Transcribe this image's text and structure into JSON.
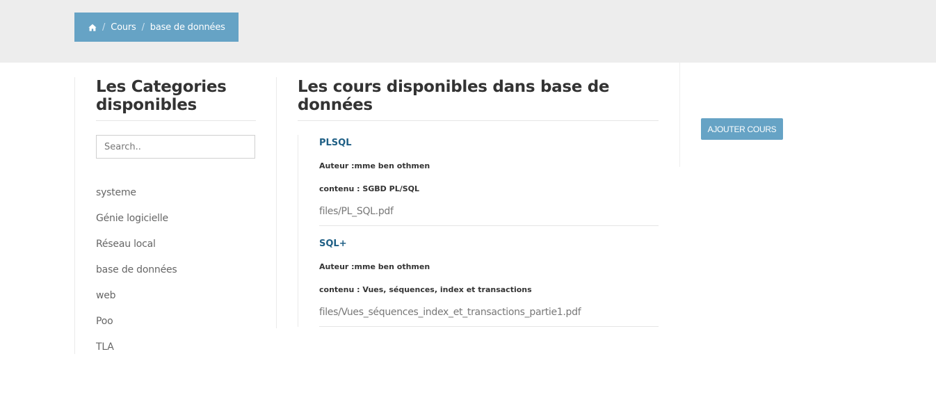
{
  "breadcrumb": {
    "home_icon": "home-icon",
    "items": [
      "Cours",
      "base de données"
    ],
    "separator": "/"
  },
  "sidebar": {
    "heading": "Les Categories disponibles",
    "search_placeholder": "Search..",
    "categories": [
      "systeme",
      "Génie logicielle",
      "Réseau local",
      "base de données",
      "web",
      "Poo",
      "TLA"
    ]
  },
  "main": {
    "heading": "Les cours disponibles dans base de données",
    "courses": [
      {
        "title": "PLSQL",
        "author": "Auteur :mme ben othmen",
        "content": "contenu : SGBD PL/SQL",
        "file": "files/PL_SQL.pdf"
      },
      {
        "title": "SQL+",
        "author": "Auteur :mme ben othmen",
        "content": "contenu : Vues, séquences, index et transactions",
        "file": "files/Vues_séquences_index_et_transactions_partie1.pdf"
      }
    ]
  },
  "actions": {
    "add_course_label": "AJOUTER COURS"
  },
  "colors": {
    "accent": "#66a3c5",
    "title_link": "#1f5f85",
    "top_band": "#ededed"
  }
}
